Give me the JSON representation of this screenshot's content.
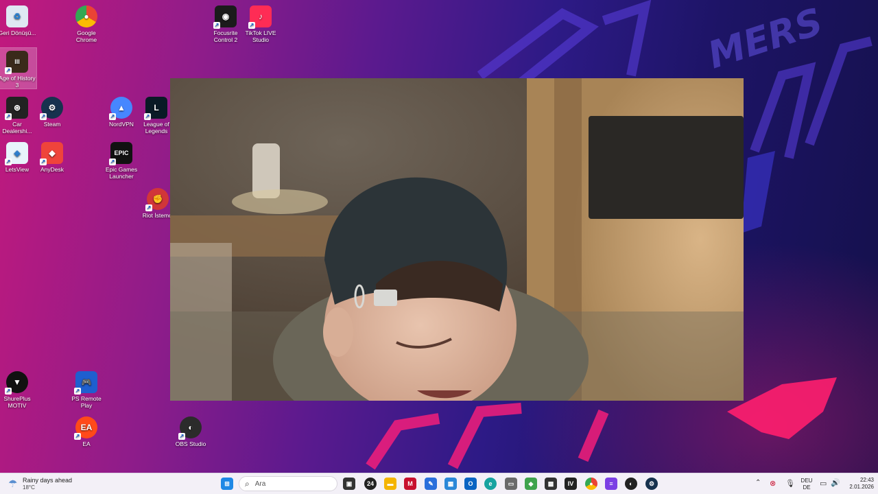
{
  "desktop_icons": [
    {
      "label": "Geri Dönüşü...",
      "icon": "recycle-bin-icon",
      "color": "#dfe8f3",
      "glyph": "♻",
      "shortcut": false,
      "selected": false
    },
    {
      "label": "Google Chrome",
      "icon": "chrome-icon",
      "color": "#ea4335",
      "glyph": "●",
      "shortcut": false,
      "selected": false
    },
    {
      "label": "Focusrite Control 2",
      "icon": "focusrite-icon",
      "color": "#1b1b1b",
      "glyph": "◉",
      "shortcut": true,
      "selected": false
    },
    {
      "label": "TikTok LIVE Studio",
      "icon": "tiktok-live-icon",
      "color": "#fe2c55",
      "glyph": "♪",
      "shortcut": true,
      "selected": false
    },
    {
      "label": "Age of History 3",
      "icon": "age-of-history-icon",
      "color": "#3a2a1a",
      "glyph": "III",
      "shortcut": true,
      "selected": true
    },
    {
      "label": "Car Dealershi...",
      "icon": "car-dealership-icon",
      "color": "#222222",
      "glyph": "⊛",
      "shortcut": true,
      "selected": false
    },
    {
      "label": "Steam",
      "icon": "steam-icon",
      "color": "#17324e",
      "glyph": "⚙",
      "shortcut": true,
      "selected": false
    },
    {
      "label": "NordVPN",
      "icon": "nordvpn-icon",
      "color": "#4687ff",
      "glyph": "▲",
      "shortcut": true,
      "selected": false
    },
    {
      "label": "League of Legends",
      "icon": "league-of-legends-icon",
      "color": "#0a1a26",
      "glyph": "L",
      "shortcut": true,
      "selected": false
    },
    {
      "label": "LetsView",
      "icon": "letsview-icon",
      "color": "#e8f4fb",
      "glyph": "◈",
      "shortcut": true,
      "selected": false
    },
    {
      "label": "AnyDesk",
      "icon": "anydesk-icon",
      "color": "#ef443b",
      "glyph": "◆",
      "shortcut": true,
      "selected": false
    },
    {
      "label": "Epic Games Launcher",
      "icon": "epic-games-icon",
      "color": "#111111",
      "glyph": "EPIC",
      "shortcut": true,
      "selected": false
    },
    {
      "label": "Riot İstemci",
      "icon": "riot-client-icon",
      "color": "#d13639",
      "glyph": "✊",
      "shortcut": true,
      "selected": false
    },
    {
      "label": "ShurePlus MOTIV",
      "icon": "shureplus-motiv-icon",
      "color": "#111111",
      "glyph": "▼",
      "shortcut": true,
      "selected": false
    },
    {
      "label": "PS Remote Play",
      "icon": "ps-remote-play-icon",
      "color": "#1f5fcf",
      "glyph": "🎮",
      "shortcut": true,
      "selected": false
    },
    {
      "label": "EA",
      "icon": "ea-icon",
      "color": "#ff4a1a",
      "glyph": "EA",
      "shortcut": true,
      "selected": false
    },
    {
      "label": "OBS Studio",
      "icon": "obs-studio-icon",
      "color": "#2b2b2b",
      "glyph": "◐",
      "shortcut": true,
      "selected": false
    }
  ],
  "taskbar": {
    "weather": {
      "title": "Rainy days ahead",
      "temp": "18°C",
      "icon": "weather-rain-icon"
    },
    "search_placeholder": "Ara",
    "apps": [
      {
        "name": "windows-start-icon",
        "color": "#1e88e5",
        "glyph": "⊞"
      },
      {
        "name": "task-view-icon",
        "color": "#333333",
        "glyph": "▣"
      },
      {
        "name": "24-app-icon",
        "color": "#222222",
        "glyph": "24"
      },
      {
        "name": "file-explorer-icon",
        "color": "#f4b400",
        "glyph": "▬"
      },
      {
        "name": "mcafee-icon",
        "color": "#c8102e",
        "glyph": "M"
      },
      {
        "name": "pen-app-icon",
        "color": "#2a6fdb",
        "glyph": "✎"
      },
      {
        "name": "store-icon",
        "color": "#2b88d8",
        "glyph": "▦"
      },
      {
        "name": "outlook-icon",
        "color": "#0a64c2",
        "glyph": "O"
      },
      {
        "name": "edge-icon",
        "color": "#17a3a0",
        "glyph": "e"
      },
      {
        "name": "photos-icon",
        "color": "#6a6a6a",
        "glyph": "▭"
      },
      {
        "name": "shield-app-icon",
        "color": "#3fa34d",
        "glyph": "◆"
      },
      {
        "name": "image-editor-icon",
        "color": "#333333",
        "glyph": "▩"
      },
      {
        "name": "iv-app-icon",
        "color": "#222222",
        "glyph": "IV"
      },
      {
        "name": "chrome-taskbar-icon",
        "color": "#34a853",
        "glyph": "●"
      },
      {
        "name": "clipchamp-icon",
        "color": "#7b3fe4",
        "glyph": "≡"
      },
      {
        "name": "obs-taskbar-icon",
        "color": "#222222",
        "glyph": "◐"
      },
      {
        "name": "steam-taskbar-icon",
        "color": "#17324e",
        "glyph": "⚙"
      }
    ],
    "tray": {
      "language_line1": "DEU",
      "language_line2": "DE",
      "time": "22:43",
      "date": "2.01.2026"
    }
  }
}
